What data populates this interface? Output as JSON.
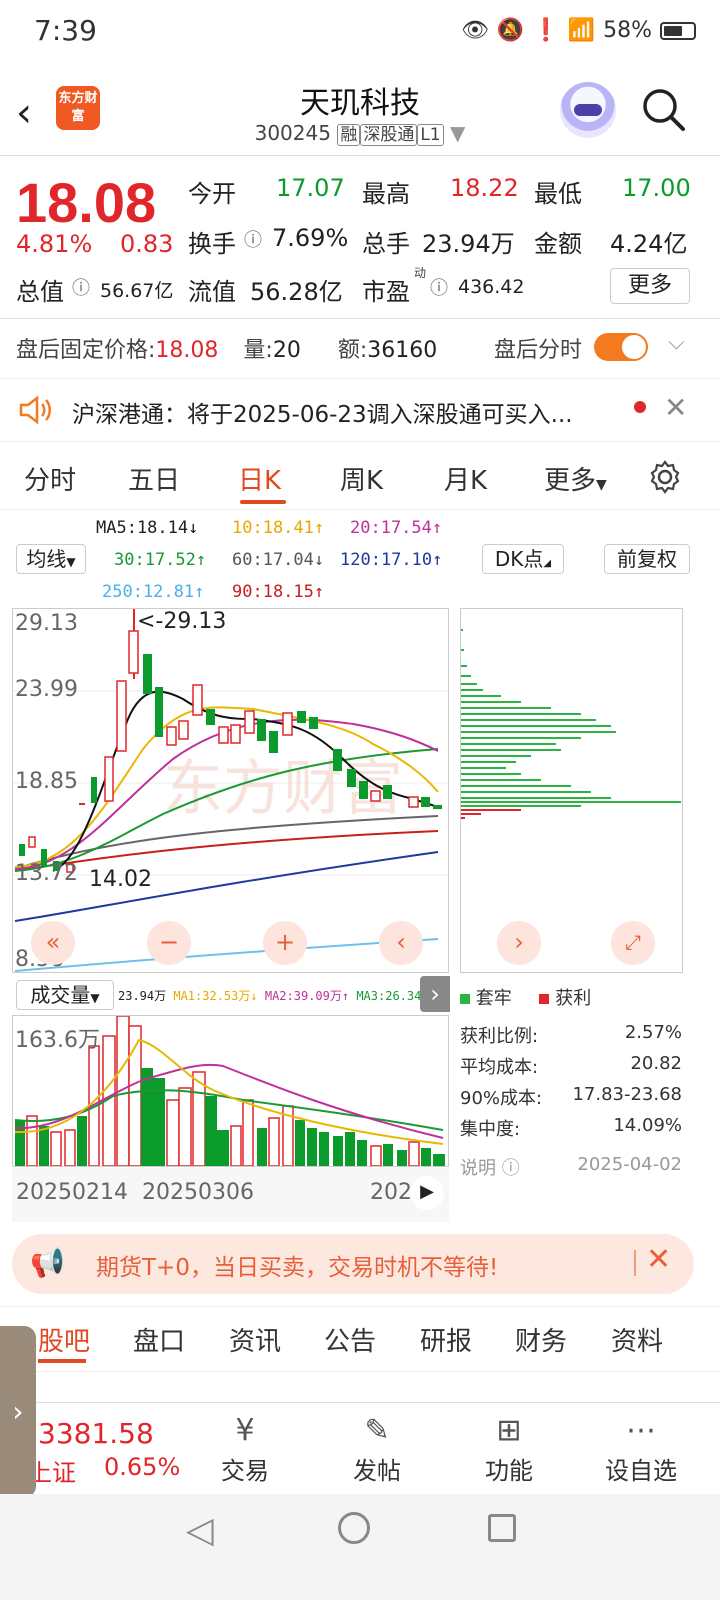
{
  "status_bar": {
    "time": "7:39",
    "battery": "58%"
  },
  "header": {
    "logo_text": "东方财富",
    "stock_name": "天玑科技",
    "stock_code": "300245",
    "tags": [
      "融",
      "深股通",
      "L1"
    ]
  },
  "quote": {
    "price": "18.08",
    "change_pct": "4.81%",
    "change": "0.83",
    "open_label": "今开",
    "open": "17.07",
    "high_label": "最高",
    "high": "18.22",
    "low_label": "最低",
    "low": "17.00",
    "turnover_label": "换手",
    "turnover": "7.69%",
    "volume_label": "总手",
    "volume": "23.94万",
    "amount_label": "金额",
    "amount": "4.24亿",
    "mktcap_label": "总值",
    "mktcap": "56.67亿",
    "float_label": "流值",
    "float": "56.28亿",
    "pe_label": "市盈",
    "pe_sup": "动",
    "pe": "436.42",
    "more_label": "更多"
  },
  "after_hours": {
    "price_label": "盘后固定价格:",
    "price": "18.08",
    "vol_label": "量:",
    "vol": "20",
    "amt_label": "额:",
    "amt": "36160",
    "toggle_label": "盘后分时"
  },
  "notice": {
    "text": "沪深港通：将于2025-06-23调入深股通可买入..."
  },
  "tabs": [
    "分时",
    "五日",
    "日K",
    "周K",
    "月K",
    "更多"
  ],
  "active_tab": "日K",
  "ma": {
    "ma_select": "均线",
    "ma5": "MA5:18.14↓",
    "ma10": "10:18.41↑",
    "ma20": "20:17.54↑",
    "ma30": "30:17.52↑",
    "ma60": "60:17.04↓",
    "ma120": "120:17.10↑",
    "ma250": "250:12.81↑",
    "ma90": "90:18.15↑",
    "dk_label": "DK点",
    "fq_label": "前复权"
  },
  "chart": {
    "y_labels": [
      "29.13",
      "23.99",
      "18.85",
      "13.72",
      "8.58"
    ],
    "max_marker": "<-29.13",
    "min_marker": "14.02"
  },
  "chip": {
    "legend_trapped": "套牢",
    "legend_profit": "获利",
    "rows": [
      {
        "label": "获利比例:",
        "value": "2.57%"
      },
      {
        "label": "平均成本:",
        "value": "20.82"
      },
      {
        "label": "90%成本:",
        "value": "17.83-23.68"
      },
      {
        "label": "集中度:",
        "value": "14.09%"
      }
    ],
    "explain_label": "说明",
    "date": "2025-04-02"
  },
  "volume": {
    "select": "成交量",
    "vol_text": "23.94万",
    "ma1": "MA1:32.53万↓",
    "ma2": "MA2:39.09万↑",
    "ma3": "MA3:26.34万↑",
    "y_label": "163.6万",
    "dates": [
      "20250214",
      "20250306",
      "202"
    ]
  },
  "banner": {
    "text": "期货T+0，当日买卖，交易时机不等待!"
  },
  "bottom_tabs": [
    "股吧",
    "盘口",
    "资讯",
    "公告",
    "研报",
    "财务",
    "资料"
  ],
  "index": {
    "value": "3381.58",
    "name": "上证",
    "pct": "0.65%"
  },
  "footer": [
    {
      "icon": "yen-icon",
      "label": "交易"
    },
    {
      "icon": "edit-icon",
      "label": "发帖"
    },
    {
      "icon": "grid-icon",
      "label": "功能"
    },
    {
      "icon": "more-icon",
      "label": "设自选"
    }
  ],
  "colors": {
    "red": "#e0262a",
    "green": "#0b9b2c",
    "accent": "#f47a20"
  }
}
